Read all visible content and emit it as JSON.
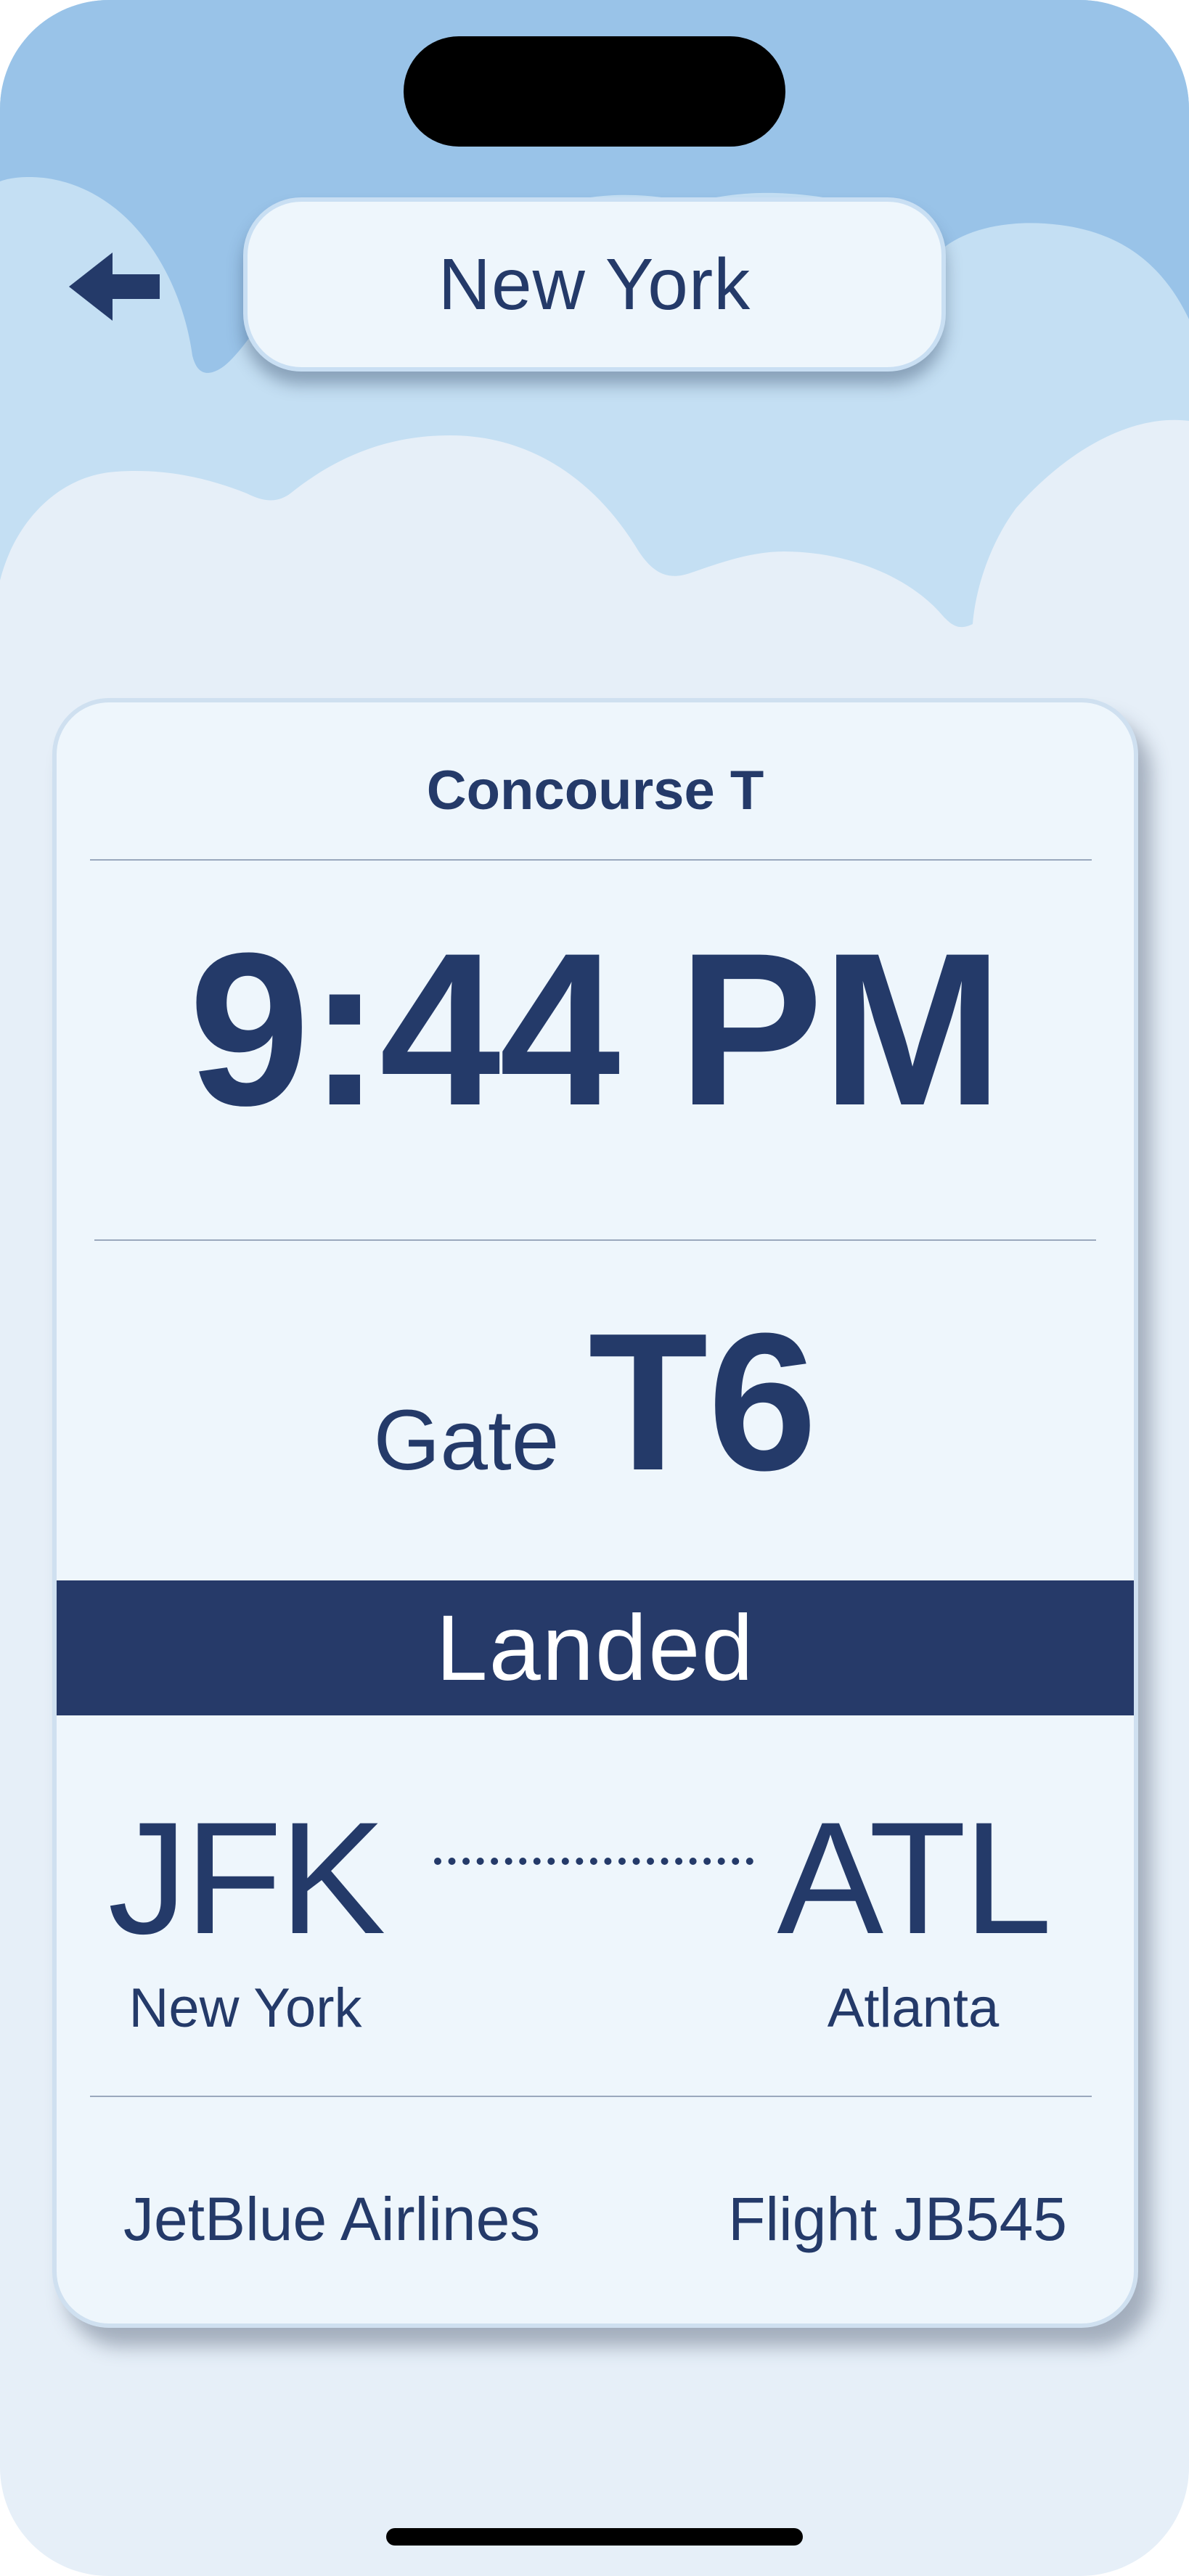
{
  "header": {
    "city_title": "New York",
    "back_icon": "arrow-left-icon"
  },
  "flight_card": {
    "concourse": "Concourse T",
    "time": "9:44 PM",
    "gate_label": "Gate",
    "gate_value": "T6",
    "status": "Landed",
    "origin": {
      "code": "JFK",
      "city": "New York"
    },
    "destination": {
      "code": "ATL",
      "city": "Atlanta"
    },
    "airline": "JetBlue Airlines",
    "flight": "Flight JB545"
  },
  "colors": {
    "primary": "#243a69",
    "card_bg": "#eef6fc",
    "sky_dark": "#99c3e8",
    "sky_mid": "#c4dff3",
    "sky_light": "#e6eff8"
  }
}
